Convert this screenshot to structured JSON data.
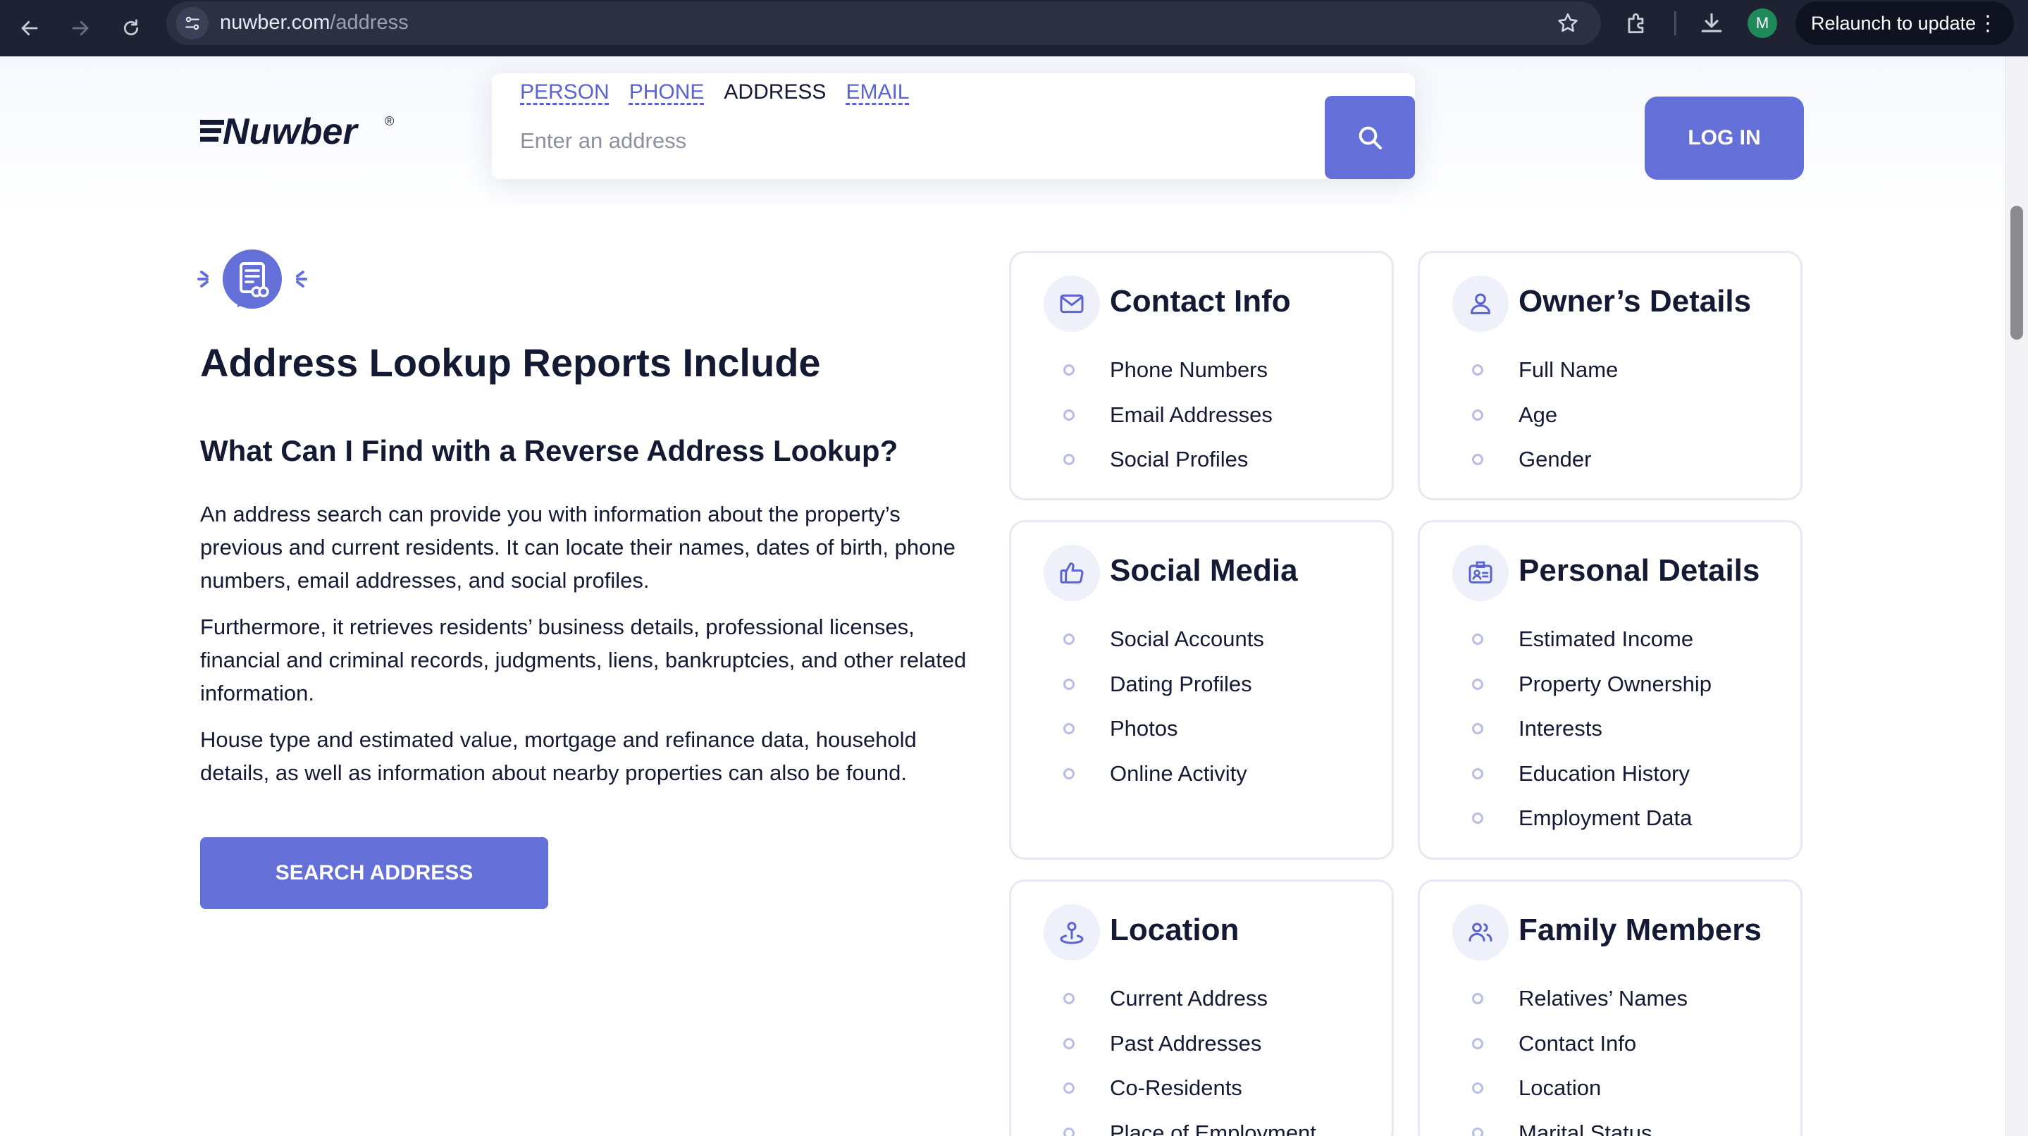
{
  "browser": {
    "url_host": "nuwber.com",
    "url_path": "/address",
    "profile_initial": "M",
    "relaunch_label": "Relaunch to update",
    "menu_glyph": "⋮"
  },
  "header": {
    "tabs": [
      "PERSON",
      "PHONE",
      "ADDRESS",
      "EMAIL"
    ],
    "active_tab": "ADDRESS",
    "search_placeholder": "Enter an address",
    "login_label": "LOG IN",
    "brand_color": "#6470d8"
  },
  "intro": {
    "title": "Address Lookup Reports Include",
    "subtitle": "What Can I Find with a Reverse Address Lookup?",
    "paragraphs": [
      "An address search can provide you with information about the property’s previous and current residents. It can locate their names, dates of birth, phone numbers, email addresses, and social profiles.",
      "Furthermore, it retrieves residents’ business details, professional licenses, financial and criminal records, judgments, liens, bankruptcies, and other related information.",
      "House type and estimated value, mortgage and refinance data, household details, as well as information about nearby properties can also be found."
    ],
    "cta_label": "SEARCH ADDRESS"
  },
  "cards": [
    {
      "title": "Contact Info",
      "icon": "envelope-icon",
      "items": [
        "Phone Numbers",
        "Email Addresses",
        "Social Profiles"
      ]
    },
    {
      "title": "Owner’s Details",
      "icon": "person-icon",
      "items": [
        "Full Name",
        "Age",
        "Gender"
      ]
    },
    {
      "title": "Social Media",
      "icon": "thumbs-up-icon",
      "items": [
        "Social Accounts",
        "Dating Profiles",
        "Photos",
        "Online Activity"
      ]
    },
    {
      "title": "Personal Details",
      "icon": "id-card-icon",
      "items": [
        "Estimated Income",
        "Property Ownership",
        "Interests",
        "Education History",
        "Employment Data"
      ]
    },
    {
      "title": "Location",
      "icon": "map-pin-icon",
      "items": [
        "Current Address",
        "Past Addresses",
        "Co-Residents",
        "Place of Employment"
      ]
    },
    {
      "title": "Family Members",
      "icon": "people-icon",
      "items": [
        "Relatives’ Names",
        "Contact Info",
        "Location",
        "Marital Status"
      ]
    }
  ]
}
